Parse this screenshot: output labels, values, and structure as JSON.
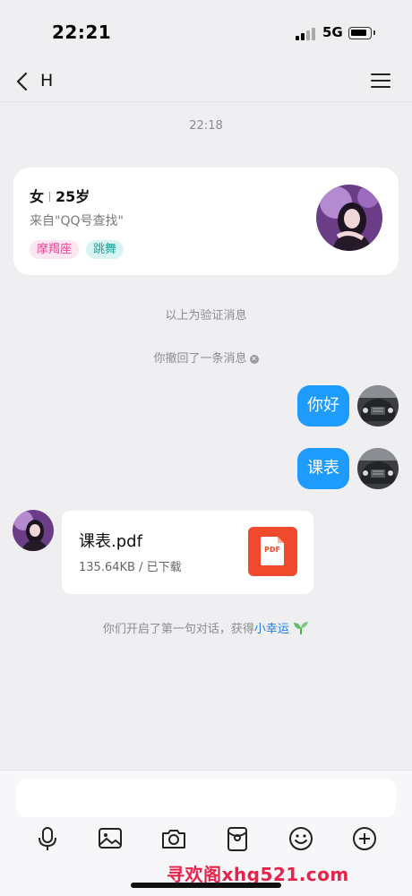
{
  "status_bar": {
    "time": "22:21",
    "network": "5G"
  },
  "nav": {
    "title": "H",
    "back_icon": "chevron-left-icon",
    "menu_icon": "hamburger-menu-icon"
  },
  "chat": {
    "timestamp": "22:18",
    "profile_card": {
      "gender": "女",
      "age": "25岁",
      "source": "来自\"QQ号查找\"",
      "tags": [
        "摩羯座",
        "跳舞"
      ]
    },
    "verify_notice": "以上为验证消息",
    "recall_notice": "你撤回了一条消息",
    "messages": [
      {
        "from": "me",
        "text": "你好"
      },
      {
        "from": "me",
        "text": "课表"
      }
    ],
    "file_message": {
      "name": "课表.pdf",
      "meta": "135.64KB / 已下载",
      "icon_label": "PDF"
    },
    "luck_notice": {
      "prefix": "你们开启了第一句对话，获得",
      "link": "小幸运",
      "icon": "sprout-icon"
    }
  },
  "toolbar": {
    "icons": [
      "microphone-icon",
      "image-icon",
      "camera-icon",
      "red-packet-icon",
      "emoji-icon",
      "plus-circle-icon"
    ]
  },
  "watermark": "寻欢阁xhg521.com",
  "colors": {
    "bubble": "#1e9bff",
    "pdf": "#f04a2d",
    "link": "#1f7de6",
    "watermark": "#e8234a"
  }
}
